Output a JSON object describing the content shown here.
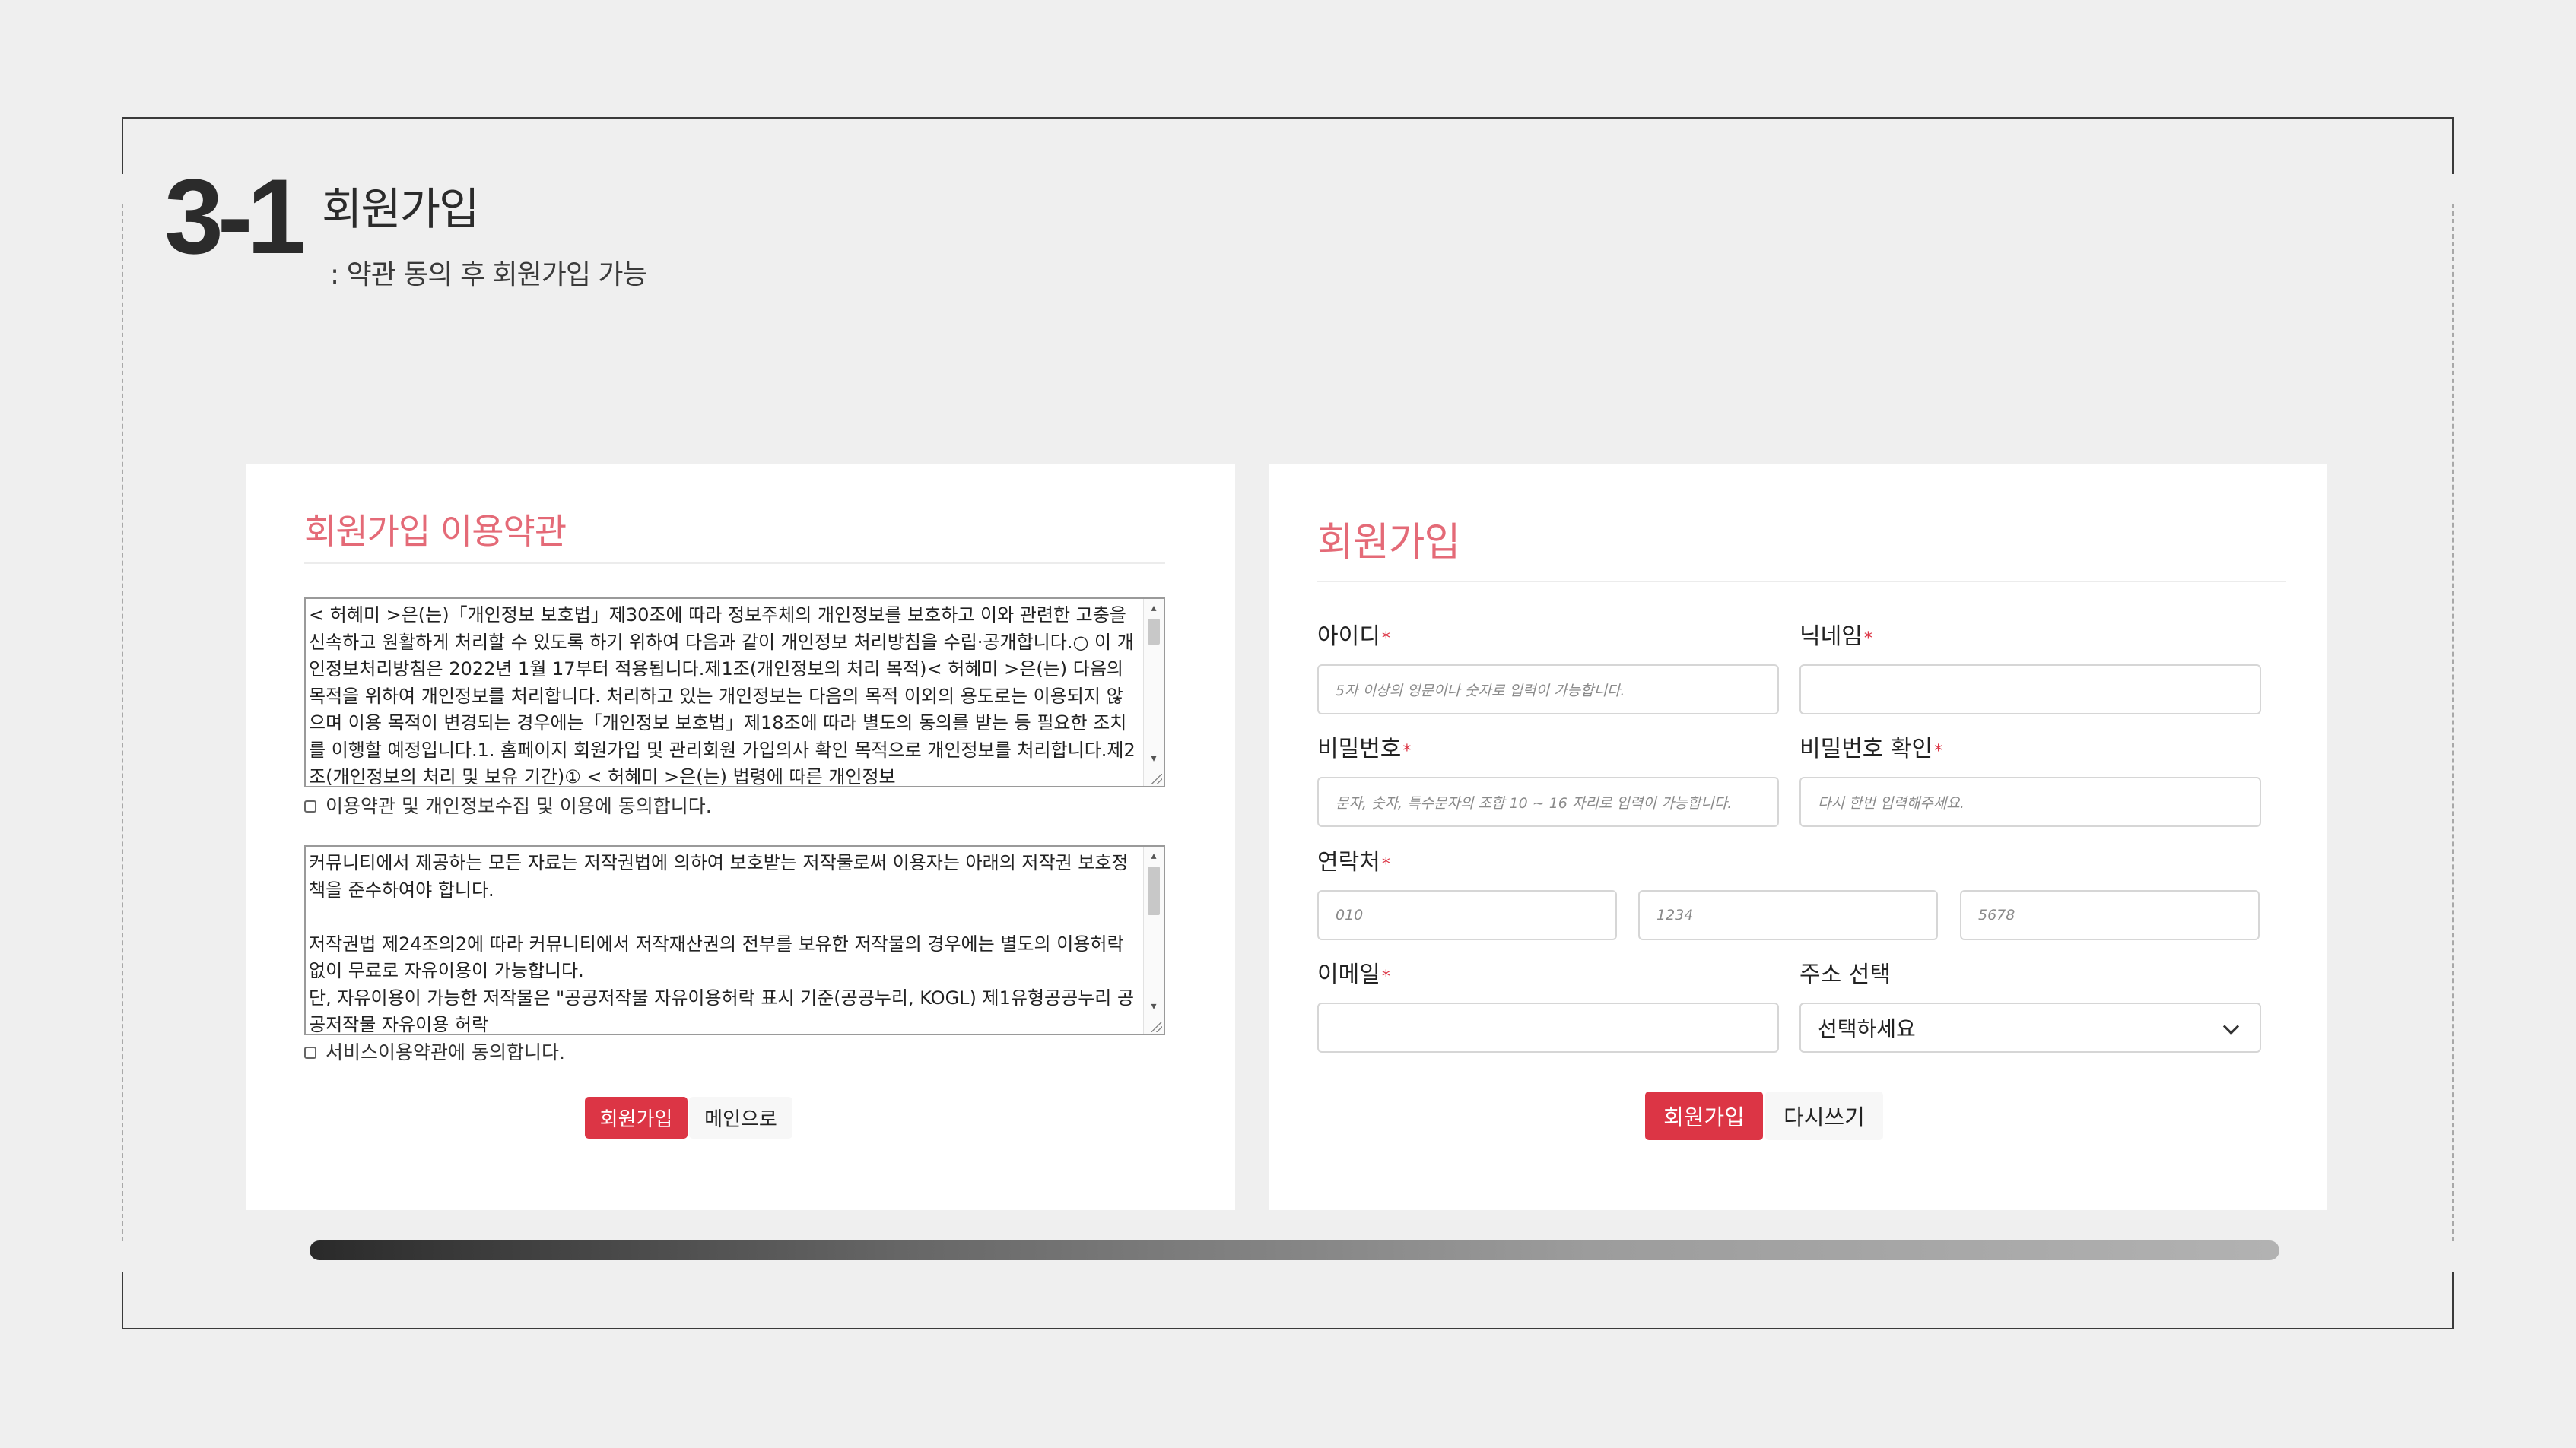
{
  "slide": {
    "number": "3-1",
    "title": "회원가입",
    "subtitle": ": 약관 동의 후 회원가입 가능"
  },
  "terms_panel": {
    "title": "회원가입 이용약관",
    "privacy_terms": "< 허혜미 >은(는)「개인정보 보호법」제30조에 따라 정보주체의 개인정보를 보호하고 이와 관련한 고충을 신속하고 원활하게 처리할 수 있도록 하기 위하여 다음과 같이 개인정보 처리방침을 수립·공개합니다.○ 이 개인정보처리방침은 2022년 1월 17부터 적용됩니다.제1조(개인정보의 처리 목적)< 허혜미 >은(는) 다음의 목적을 위하여 개인정보를 처리합니다. 처리하고 있는 개인정보는 다음의 목적 이외의 용도로는 이용되지 않으며 이용 목적이 변경되는 경우에는「개인정보 보호법」제18조에 따라 별도의 동의를 받는 등 필요한 조치를 이행할 예정입니다.1. 홈페이지 회원가입 및 관리회원 가입의사 확인 목적으로 개인정보를 처리합니다.제2조(개인정보의 처리 및 보유 기간)① < 허혜미 >은(는) 법령에 따른 개인정보",
    "privacy_agree": "이용약관 및 개인정보수집 및 이용에 동의합니다.",
    "service_terms": "커뮤니티에서 제공하는 모든 자료는 저작권법에 의하여 보호받는 저작물로써 이용자는 아래의 저작권 보호정책을 준수하여야 합니다.\n\n저작권법 제24조의2에 따라 커뮤니티에서 저작재산권의 전부를 보유한 저작물의 경우에는 별도의 이용허락 없이 무료로 자유이용이 가능합니다.\n단, 자유이용이 가능한 저작물은 \"공공저작물 자유이용허락 표시 기준(공공누리, KOGL) 제1유형공공누리 공공저작물 자유이용 허락",
    "service_agree": "서비스이용약관에 동의합니다.",
    "signup_button": "회원가입",
    "main_button": "메인으로"
  },
  "form_panel": {
    "title": "회원가입",
    "required_mark": "*",
    "id_label": "아이디",
    "id_placeholder": "5자 이상의 영문이나 숫자로 입력이 가능합니다.",
    "nickname_label": "닉네임",
    "nickname_placeholder": "",
    "password_label": "비밀번호",
    "password_placeholder": "문자, 숫자, 특수문자의 조합 10 ~ 16 자리로 입력이 가능합니다.",
    "password_confirm_label": "비밀번호 확인",
    "password_confirm_placeholder": "다시 한번 입력해주세요.",
    "phone_label": "연락처",
    "phone_placeholders": [
      "010",
      "1234",
      "5678"
    ],
    "email_label": "이메일",
    "email_placeholder": "",
    "address_label": "주소 선택",
    "address_selected": "선택하세요",
    "signup_button": "회원가입",
    "reset_button": "다시쓰기"
  },
  "colors": {
    "accent": "#e46a77",
    "button_red": "#dc3545",
    "background": "#efefef",
    "panel": "#ffffff"
  },
  "icons": [
    "chevron-down-icon",
    "scroll-up-arrow-icon",
    "scroll-down-arrow-icon",
    "resize-grip-icon"
  ]
}
